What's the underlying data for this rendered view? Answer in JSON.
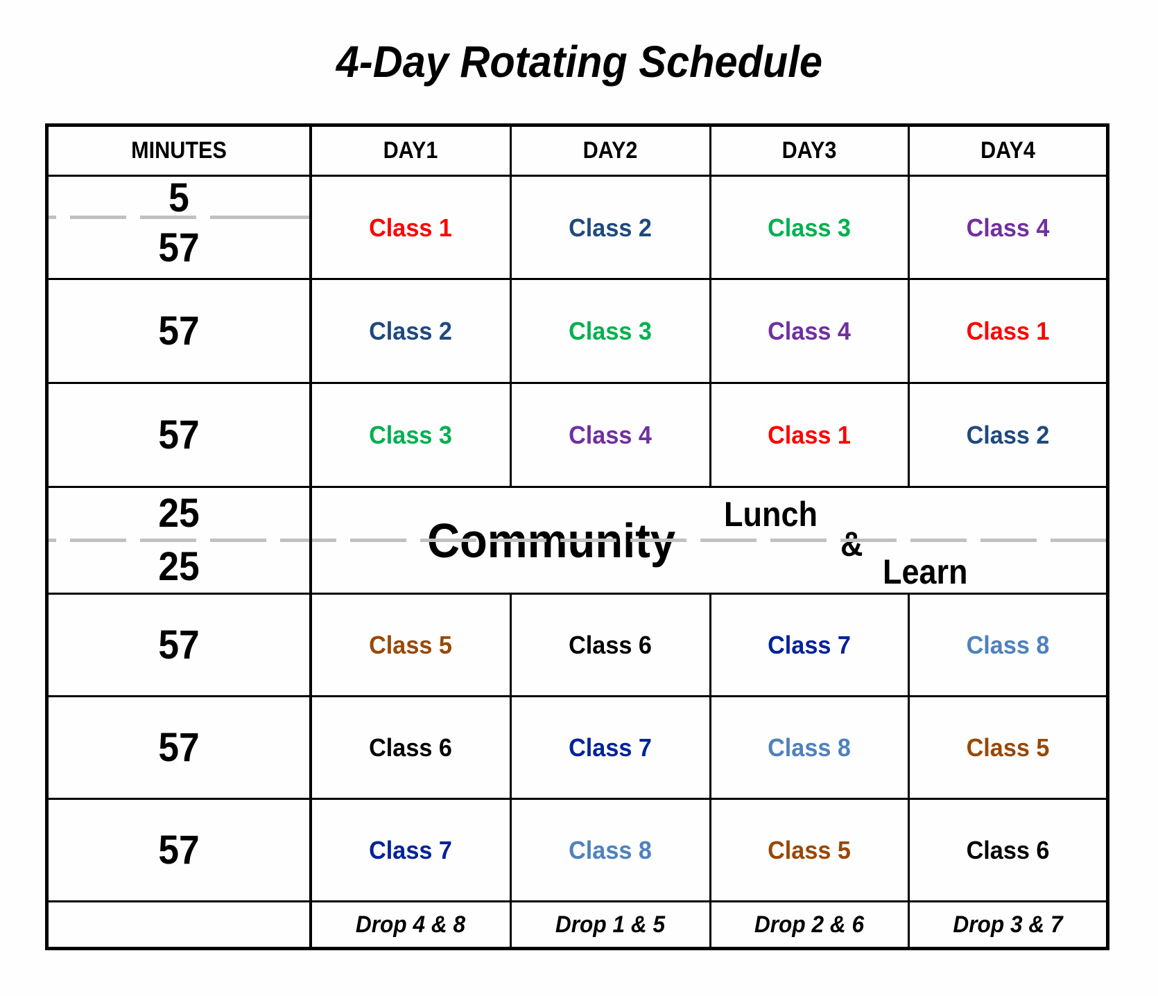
{
  "title": "4-Day Rotating Schedule",
  "header": {
    "minutes_label": "MINUTES",
    "days": [
      "DAY1",
      "DAY2",
      "DAY3",
      "DAY4"
    ]
  },
  "colors": {
    "Class 1": "#ff0000",
    "Class 2": "#1f497d",
    "Class 3": "#00b050",
    "Class 4": "#7030a0",
    "Class 5": "#984807",
    "Class 6": "#000000",
    "Class 7": "#002299",
    "Class 8": "#4f81bd"
  },
  "rows": [
    {
      "minutes": [
        "5",
        "57"
      ],
      "classes": [
        "Class 1",
        "Class 2",
        "Class 3",
        "Class 4"
      ]
    },
    {
      "minutes": [
        "57"
      ],
      "classes": [
        "Class 2",
        "Class 3",
        "Class 4",
        "Class 1"
      ]
    },
    {
      "minutes": [
        "57"
      ],
      "classes": [
        "Class 3",
        "Class 4",
        "Class 1",
        "Class 2"
      ]
    },
    {
      "minutes": [
        "25",
        "25"
      ],
      "community": "Community",
      "lunch": "Lunch",
      "amp": "&",
      "learn": "Learn"
    },
    {
      "minutes": [
        "57"
      ],
      "classes": [
        "Class 5",
        "Class 6",
        "Class 7",
        "Class 8"
      ]
    },
    {
      "minutes": [
        "57"
      ],
      "classes": [
        "Class 6",
        "Class 7",
        "Class 8",
        "Class 5"
      ]
    },
    {
      "minutes": [
        "57"
      ],
      "classes": [
        "Class 7",
        "Class 8",
        "Class 5",
        "Class 6"
      ]
    }
  ],
  "footer": {
    "minutes": "",
    "drops": [
      "Drop 4 & 8",
      "Drop 1 & 5",
      "Drop 2 & 6",
      "Drop 3 & 7"
    ]
  }
}
